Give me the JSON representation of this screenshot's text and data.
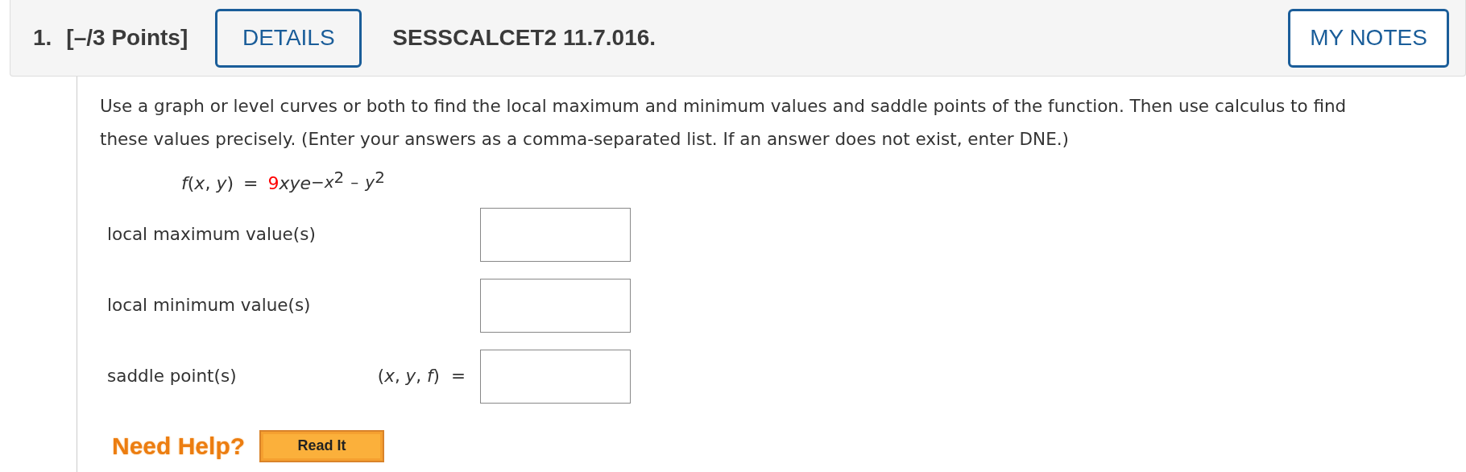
{
  "question": {
    "number": "1.",
    "points": "[–/3 Points]",
    "details_button": "DETAILS",
    "problem_id": "SESSCALCET2 11.7.016.",
    "notes_button": "MY NOTES"
  },
  "prompt": "Use a graph or level curves or both to find the local maximum and minimum values and saddle points of the function. Then use calculus to find these values precisely. (Enter your answers as a comma-separated list. If an answer does not exist, enter DNE.)",
  "formula": {
    "lhs": "*f*(*x*, *y*)",
    "equals": "=",
    "coefficient": "9",
    "base": "xye",
    "exponent": [
      {
        "text": "−x",
        "kind": "var"
      },
      {
        "text": "2",
        "kind": "power"
      },
      {
        "text": "–",
        "kind": "op"
      },
      {
        "text": "y",
        "kind": "var"
      },
      {
        "text": "2",
        "kind": "power"
      }
    ]
  },
  "answers": [
    {
      "label": "local maximum value(s)"
    },
    {
      "label": "local minimum value(s)"
    },
    {
      "label": "saddle point(s)",
      "prefix": "(*x*, *y*, *f*)",
      "equals": "="
    }
  ],
  "help": {
    "label": "Need Help?",
    "buttons": [
      "Read It"
    ]
  }
}
